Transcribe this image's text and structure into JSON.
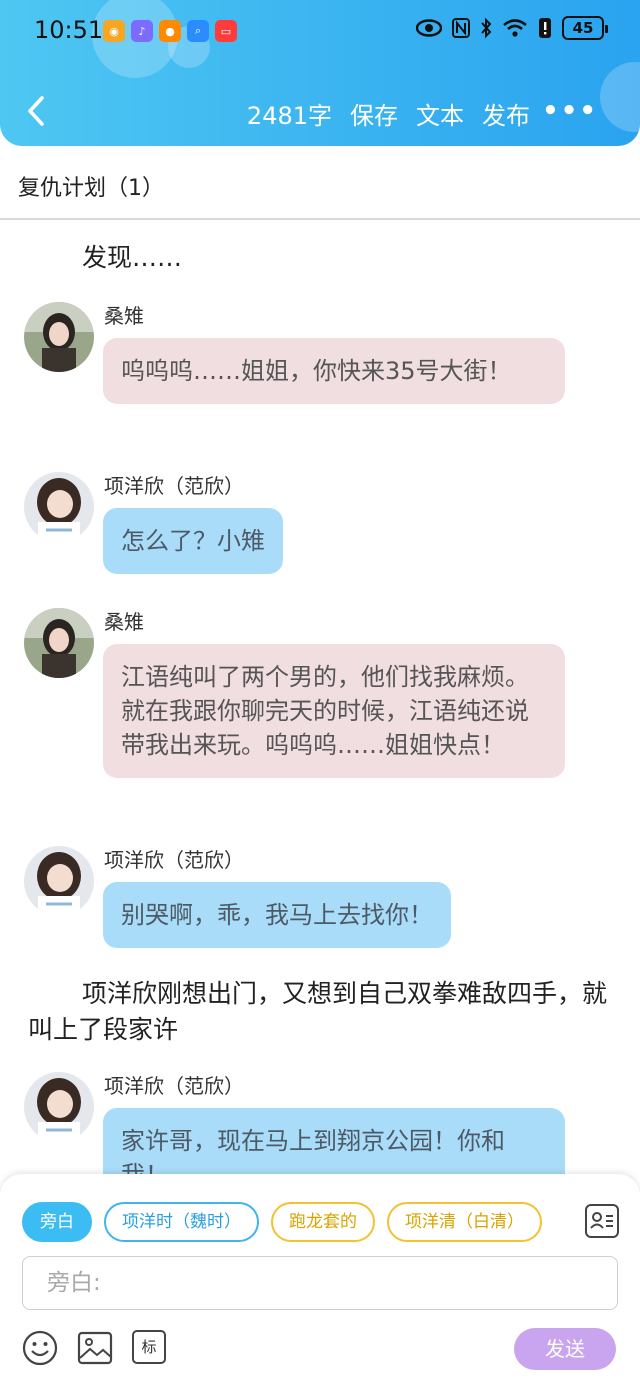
{
  "status_bar": {
    "time": "10:51",
    "battery": "45"
  },
  "nav": {
    "word_count": "2481字",
    "save": "保存",
    "text": "文本",
    "publish": "发布",
    "more": "•••"
  },
  "chapter": {
    "title": "复仇计划（1）"
  },
  "content": {
    "narration_1": "发现……",
    "messages": [
      {
        "speaker": "桑雉",
        "text": "呜呜呜……姐姐，你快来35号大街！",
        "style": "pink"
      },
      {
        "speaker": "项洋欣（范欣）",
        "text": "怎么了？小雉",
        "style": "blue"
      },
      {
        "speaker": "桑雉",
        "text": "江语纯叫了两个男的，他们找我麻烦。就在我跟你聊完天的时候，江语纯还说带我出来玩。呜呜呜……姐姐快点！",
        "style": "pink"
      },
      {
        "speaker": "项洋欣（范欣）",
        "text": "别哭啊，乖，我马上去找你！",
        "style": "blue"
      },
      {
        "speaker": "项洋欣（范欣）",
        "text": "家许哥，现在马上到翔京公园！你和我！",
        "style": "blue"
      }
    ],
    "narration_2": "项洋欣刚想出门，又想到自己双拳难敌四手，就叫上了段家许"
  },
  "bottom": {
    "roles": [
      {
        "label": "旁白",
        "style": "active"
      },
      {
        "label": "项洋时（魏时）",
        "style": "blue"
      },
      {
        "label": "跑龙套的",
        "style": "yellow"
      },
      {
        "label": "项洋清（白清）",
        "style": "yellow"
      }
    ],
    "input_placeholder": "旁白:",
    "tag_label": "标",
    "send_label": "发送"
  }
}
